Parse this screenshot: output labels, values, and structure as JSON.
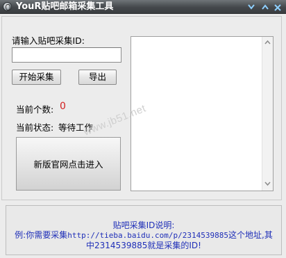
{
  "window": {
    "title": "YouR贴吧邮箱采集工具"
  },
  "form": {
    "id_label": "请输入贴吧采集ID:",
    "id_value": "",
    "start_button": "开始采集",
    "export_button": "导出"
  },
  "status": {
    "count_label": "当前个数:",
    "count_value": "0",
    "state_label": "当前状态:",
    "state_value": "等待工作"
  },
  "enter_site_button": "新版官网点击进入",
  "watermark": "www.jb51.net",
  "info": {
    "title": "贴吧采集ID说明:",
    "line2_prefix": "例:你需要采集",
    "line2_url": "http://tieba.baidu.com/p/2314539885",
    "line2_suffix": "这个地址,其",
    "line3": "中2314539885就是采集的ID!"
  },
  "colors": {
    "title_bar": "#44484b",
    "count_value": "#d21f1f",
    "info_text": "#1f2fb8",
    "window_controls": "#8fd0ff"
  }
}
